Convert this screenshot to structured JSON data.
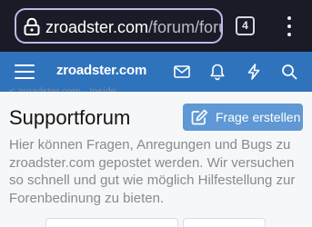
{
  "browser": {
    "url_host": "zroadster.com",
    "url_path": "/forum/foru",
    "tabs_count": "4"
  },
  "header": {
    "logo": "zroadster.com",
    "icons": [
      "menu-icon",
      "mail-icon",
      "bell-icon",
      "bolt-icon",
      "search-icon"
    ],
    "bg_color": "#2f73bd"
  },
  "breadcrumb": {
    "text": "< zroadster.com - Inside"
  },
  "main": {
    "title": "Supportforum",
    "new_thread_label": "Frage erstellen",
    "description": "Hier können Fragen, Anregungen und Bugs zu zroadster.com gepostet werden. Wir versuchen so schnell und gut wie möglich Hilfestellung zur Forenbedinung zu bieten."
  },
  "colors": {
    "accent_button": "#5f98d4",
    "browser_bar": "#1b1b27"
  }
}
